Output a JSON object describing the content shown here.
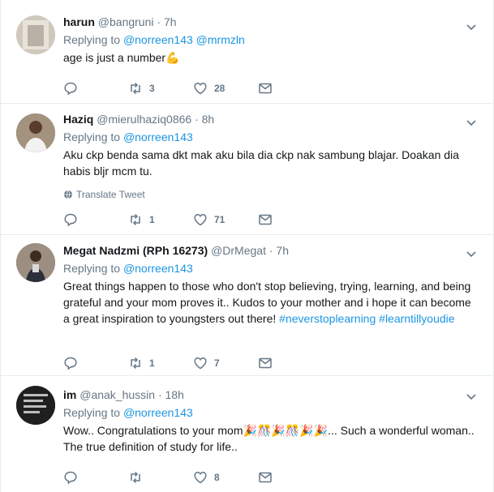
{
  "tweets": [
    {
      "name": "harun",
      "handle": "@bangruni",
      "sep": " · ",
      "time": "7h",
      "replying_prefix": "Replying to",
      "replying_to": [
        "@norreen143",
        "@mrmzln"
      ],
      "text": "age is just a number",
      "emoji": "💪",
      "replies": "",
      "retweets": "3",
      "likes": "28",
      "translate": "",
      "avatar_color": "#d8d3cc"
    },
    {
      "name": "Haziq",
      "handle": "@mierulhaziq0866",
      "sep": " · ",
      "time": "8h",
      "replying_prefix": "Replying to",
      "replying_to": [
        "@norreen143"
      ],
      "text": "Aku ckp benda sama dkt mak aku bila dia ckp nak sambung blajar. Doakan dia habis bljr mcm tu.",
      "emoji": "",
      "replies": "",
      "retweets": "1",
      "likes": "71",
      "translate": "Translate Tweet",
      "avatar_color": "#6b5a48"
    },
    {
      "name": "Megat Nadzmi (RPh 16273)",
      "handle": "@DrMegat",
      "sep": " · ",
      "time": "7h",
      "replying_prefix": "Replying to",
      "replying_to": [
        "@norreen143"
      ],
      "text": "Great things happen to those who don't stop believing, trying, learning, and being grateful and your mom proves it.. Kudos to your mother and i hope it can become a great inspiration to youngsters out there!",
      "hashtags": [
        "#neverstoplearning",
        "#learntillyoudie"
      ],
      "replies": "",
      "retweets": "1",
      "likes": "7",
      "translate": "",
      "avatar_color": "#8a7c70"
    },
    {
      "name": "im",
      "handle": "@anak_hussin",
      "sep": " · ",
      "time": "18h",
      "replying_prefix": "Replying to",
      "replying_to": [
        "@norreen143"
      ],
      "text_before": "Wow.. Congratulations to your mom",
      "emojis": "🎉🎊🎉🎊🎉🎉",
      "text_after": "... Such a wonderful woman.. The true definition of study for life..",
      "replies": "",
      "retweets": "",
      "likes": "8",
      "translate": "",
      "avatar_color": "#2c2c2c"
    }
  ],
  "colors": {
    "accent": "#1b95e0",
    "muted": "#657786",
    "border": "#e6ecf0"
  }
}
